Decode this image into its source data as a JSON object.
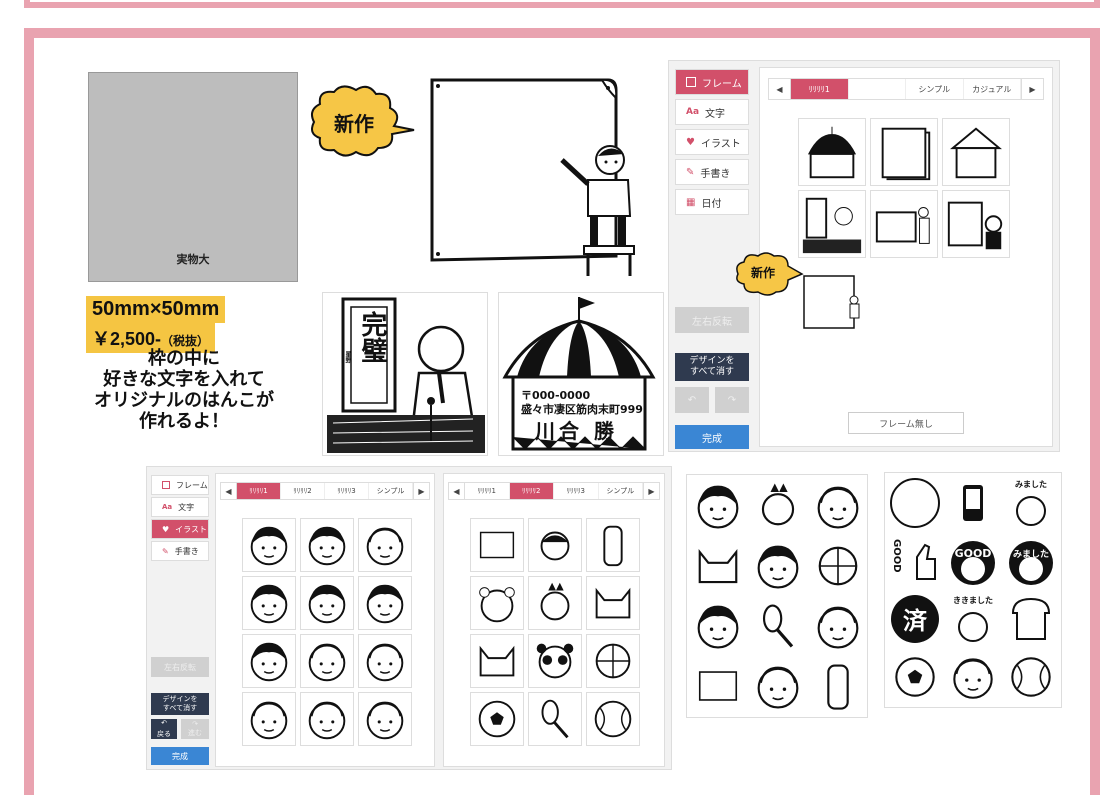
{
  "actual_size_label": "実物大",
  "size": "50mm×50mm",
  "price": "￥2,500-",
  "tax_note": "（税抜）",
  "tagline": [
    "枠の中に",
    "好きな文字を入れて",
    "オリジナルのはんこが",
    "作れるよ！"
  ],
  "new_badge": "新作",
  "stamp_samples": {
    "kanpeki": "完璧",
    "kanpeki_small": "星野",
    "postal": "〒000-0000",
    "address": "盛々市凄区筋肉末町999",
    "name": "川合 勝"
  },
  "editor_main": {
    "sidebar": [
      "フレーム",
      "文字",
      "イラスト",
      "手書き",
      "日付"
    ],
    "reflect_label": "左右反転",
    "clear_all": [
      "デザインを",
      "すべて消す"
    ],
    "done": "完成",
    "tabs": [
      "ﾘﾘﾘﾘ1",
      "シンプル",
      "カジュアル"
    ],
    "no_frame": "フレーム無し"
  },
  "editor_illust": {
    "sidebar": [
      "フレーム",
      "文字",
      "イラスト",
      "手書き"
    ],
    "reflect_label": "左右反転",
    "clear_all": [
      "デザインを",
      "すべて消す"
    ],
    "back": "戻る",
    "forward": "進む",
    "done": "完成",
    "tabs_a": [
      "ﾘﾘﾘﾘ1",
      "ﾘﾘﾘﾘ2",
      "ﾘﾘﾘﾘ3",
      "シンプル"
    ],
    "tabs_b": [
      "ﾘﾘﾘﾘ1",
      "ﾘﾘﾘﾘ2",
      "ﾘﾘﾘﾘ3",
      "シンプル"
    ]
  },
  "stamp_words": {
    "good": "GOOD",
    "mimashita": "みました",
    "mimashita2": "みました",
    "sumi": "済",
    "kikimashita": "ききました",
    "go": "GOOD"
  },
  "colors": {
    "frame_pink": "#e9a3b0",
    "accent_red": "#d2506a",
    "price_yellow": "#f5c542",
    "burst_yellow": "#f6c646",
    "done_blue": "#3a86d4",
    "dark_button": "#2f3a4f"
  }
}
